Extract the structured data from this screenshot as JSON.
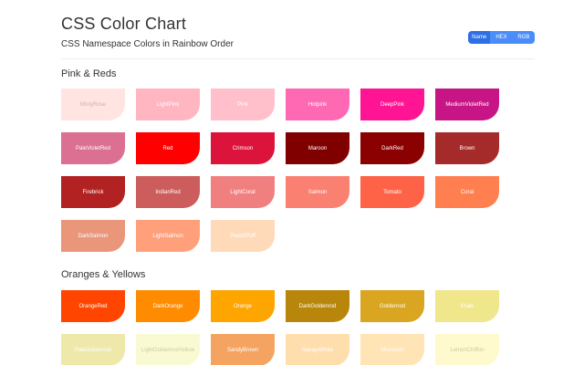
{
  "header": {
    "title": "CSS Color Chart",
    "subtitle": "CSS Namespace Colors in Rainbow Order"
  },
  "toggle": {
    "options": [
      {
        "label": "Name",
        "active": true
      },
      {
        "label": "HEX",
        "active": false
      },
      {
        "label": "RGB",
        "active": false
      }
    ]
  },
  "sections": [
    {
      "title": "Pink & Reds",
      "colors": [
        {
          "name": "MistyRose",
          "hex": "#FFE4E1",
          "text": "#c8b4b2"
        },
        {
          "name": "LightPink",
          "hex": "#FFB6C1",
          "text": "#ffffff"
        },
        {
          "name": "Pink",
          "hex": "#FFC0CB",
          "text": "#ffffff"
        },
        {
          "name": "Hotpink",
          "hex": "#FF69B4",
          "text": "#ffffff"
        },
        {
          "name": "DeepPink",
          "hex": "#FF1493",
          "text": "#ffffff"
        },
        {
          "name": "MediumVioletRed",
          "hex": "#C71585",
          "text": "#ffffff"
        },
        {
          "name": "PaleVioletRed",
          "hex": "#DB7093",
          "text": "#ffffff"
        },
        {
          "name": "Red",
          "hex": "#FF0000",
          "text": "#ffffff"
        },
        {
          "name": "Crimson",
          "hex": "#DC143C",
          "text": "#ffffff"
        },
        {
          "name": "Maroon",
          "hex": "#800000",
          "text": "#ffffff"
        },
        {
          "name": "DarkRed",
          "hex": "#8B0000",
          "text": "#ffffff"
        },
        {
          "name": "Brown",
          "hex": "#A52A2A",
          "text": "#ffffff"
        },
        {
          "name": "Firebrick",
          "hex": "#B22222",
          "text": "#ffffff"
        },
        {
          "name": "IndianRed",
          "hex": "#CD5C5C",
          "text": "#ffffff"
        },
        {
          "name": "LightCoral",
          "hex": "#F08080",
          "text": "#ffffff"
        },
        {
          "name": "Salmon",
          "hex": "#FA8072",
          "text": "#ffffff"
        },
        {
          "name": "Tomato",
          "hex": "#FF6347",
          "text": "#ffffff"
        },
        {
          "name": "Coral",
          "hex": "#FF7F50",
          "text": "#ffffff"
        },
        {
          "name": "DarkSalmon",
          "hex": "#E9967A",
          "text": "#ffffff"
        },
        {
          "name": "LightSalmon",
          "hex": "#FFA07A",
          "text": "#ffffff"
        },
        {
          "name": "PeachPuff",
          "hex": "#FFDAB9",
          "text": "#ffffff"
        }
      ]
    },
    {
      "title": "Oranges & Yellows",
      "colors": [
        {
          "name": "OrangeRed",
          "hex": "#FF4500",
          "text": "#ffffff"
        },
        {
          "name": "DarkOrange",
          "hex": "#FF8C00",
          "text": "#ffffff"
        },
        {
          "name": "Orange",
          "hex": "#FFA500",
          "text": "#ffffff"
        },
        {
          "name": "DarkGoldenrod",
          "hex": "#B8860B",
          "text": "#ffffff"
        },
        {
          "name": "Goldenrod",
          "hex": "#DAA520",
          "text": "#ffffff"
        },
        {
          "name": "Khaki",
          "hex": "#F0E68C",
          "text": "#ffffff"
        },
        {
          "name": "PaleGoldenrod",
          "hex": "#EEE8AA",
          "text": "#ffffff"
        },
        {
          "name": "LightGoldenrodYellow",
          "hex": "#FAFAD2",
          "text": "#c9c9a8"
        },
        {
          "name": "SandyBrown",
          "hex": "#F4A460",
          "text": "#ffffff"
        },
        {
          "name": "NavajoWhite",
          "hex": "#FFDEAD",
          "text": "#ffffff"
        },
        {
          "name": "Moccasin",
          "hex": "#FFE4B5",
          "text": "#ffffff"
        },
        {
          "name": "LemonChiffon",
          "hex": "#FFFACD",
          "text": "#cdc8a4"
        }
      ]
    }
  ]
}
